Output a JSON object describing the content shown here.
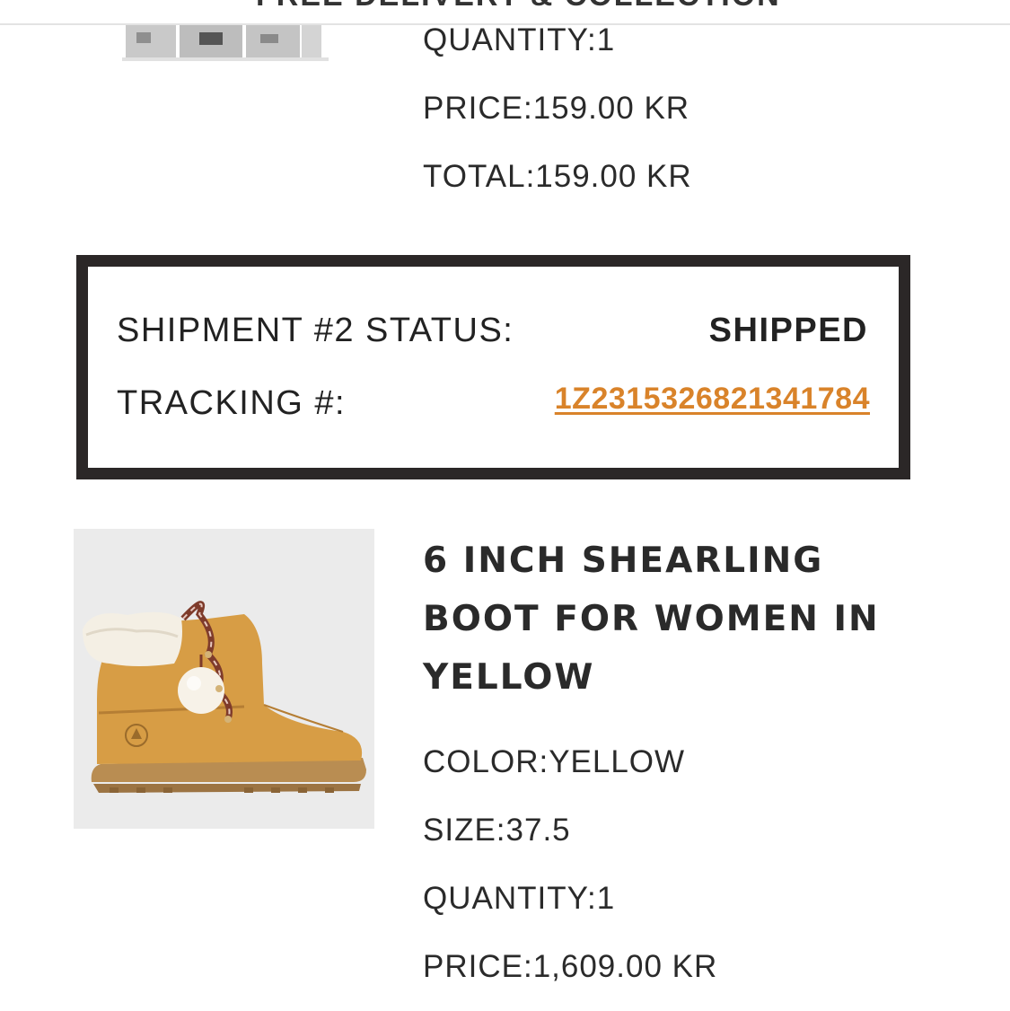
{
  "header": {
    "banner_text": "FREE DELIVERY & COLLECTION"
  },
  "previous_item": {
    "quantity": "QUANTITY:1",
    "price": "PRICE:159.00 KR",
    "total": "TOTAL:159.00 KR"
  },
  "shipment": {
    "status_label": "SHIPMENT #2 STATUS:",
    "status_value": "SHIPPED",
    "tracking_label": "TRACKING #:",
    "tracking_number": "1Z2315326821341784",
    "link_color": "#d9832a"
  },
  "product": {
    "title": "6 INCH SHEARLING BOOT FOR WOMEN IN YELLOW",
    "color": "COLOR:YELLOW",
    "size": "SIZE:37.5",
    "quantity": "QUANTITY:1",
    "price": "PRICE:1,609.00 KR",
    "image_alt": "yellow shearling boot photo"
  }
}
